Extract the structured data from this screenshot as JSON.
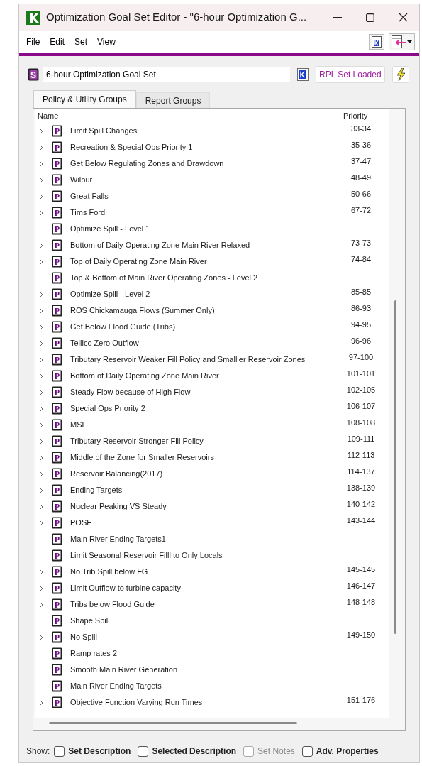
{
  "window": {
    "title": "Optimization Goal Set Editor - \"6-hour Optimization G..."
  },
  "menu": [
    "File",
    "Edit",
    "Set",
    "View"
  ],
  "set_name": {
    "icon": "S",
    "value": "6-hour Optimization Goal Set"
  },
  "rpl_status": "RPL Set Loaded",
  "tabs": [
    {
      "label": "Policy & Utility Groups",
      "selected": true
    },
    {
      "label": "Report Groups",
      "selected": false
    }
  ],
  "tree": {
    "columns": [
      "Name",
      "Priority"
    ],
    "rows": [
      {
        "icon": "P",
        "name": "Limit Spill Changes",
        "priority": "33-34",
        "expandable": true
      },
      {
        "icon": "P",
        "name": "Recreation & Special Ops Priority 1",
        "priority": "35-36",
        "expandable": true
      },
      {
        "icon": "P",
        "name": "Get Below Regulating Zones and Drawdown",
        "priority": "37-47",
        "expandable": true
      },
      {
        "icon": "P",
        "name": "Wilbur",
        "priority": "48-49",
        "expandable": true
      },
      {
        "icon": "P",
        "name": "Great Falls",
        "priority": "50-66",
        "expandable": true
      },
      {
        "icon": "P",
        "name": "Tims Ford",
        "priority": "67-72",
        "expandable": true
      },
      {
        "icon": "P",
        "name": "Optimize Spill - Level 1",
        "expandable": false
      },
      {
        "icon": "P",
        "name": "Bottom of Daily Operating Zone Main River Relaxed",
        "priority": "73-73",
        "expandable": true
      },
      {
        "icon": "P",
        "name": "Top of Daily Operating Zone Main River",
        "priority": "74-84",
        "expandable": true
      },
      {
        "icon": "P",
        "name": "Top & Bottom of Main River Operating Zones - Level 2",
        "expandable": false
      },
      {
        "icon": "P",
        "name": "Optimize Spill - Level 2",
        "priority": "85-85",
        "expandable": true
      },
      {
        "icon": "P",
        "name": "ROS Chickamauga Flows (Summer Only)",
        "priority": "86-93",
        "expandable": true
      },
      {
        "icon": "P",
        "name": "Get Below Flood Guide (Tribs)",
        "priority": "94-95",
        "expandable": true
      },
      {
        "icon": "P",
        "name": "Tellico Zero Outflow",
        "priority": "96-96",
        "expandable": true
      },
      {
        "icon": "P",
        "name": "Tributary Reservoir Weaker Fill Policy and Smalller Reservoir Zones",
        "priority": "97-100",
        "expandable": true
      },
      {
        "icon": "P",
        "name": "Bottom of Daily Operating Zone Main River",
        "priority": "101-101",
        "expandable": true
      },
      {
        "icon": "P",
        "name": "Steady Flow because of High Flow",
        "priority": "102-105",
        "expandable": true
      },
      {
        "icon": "P",
        "name": "Special Ops Priority 2",
        "priority": "106-107",
        "expandable": true
      },
      {
        "icon": "P",
        "name": "MSL",
        "priority": "108-108",
        "expandable": true
      },
      {
        "icon": "P",
        "name": "Tributary Reservoir Stronger Fill Policy",
        "priority": "109-111",
        "expandable": true
      },
      {
        "icon": "P",
        "name": "Middle of the Zone for Smaller Reservoirs",
        "priority": "112-113",
        "expandable": true
      },
      {
        "icon": "P",
        "name": "Reservoir Balancing(2017)",
        "priority": "114-137",
        "expandable": true
      },
      {
        "icon": "P",
        "name": "Ending Targets",
        "priority": "138-139",
        "expandable": true
      },
      {
        "icon": "P",
        "name": "Nuclear Peaking VS Steady",
        "priority": "140-142",
        "expandable": true
      },
      {
        "icon": "P",
        "name": "POSE",
        "priority": "143-144",
        "expandable": true
      },
      {
        "icon": "P",
        "name": "Main River Ending Targets1",
        "expandable": false
      },
      {
        "icon": "P",
        "name": "Limit Seasonal Reservoir Filll to Only Locals",
        "expandable": false
      },
      {
        "icon": "P",
        "name": "No Trib Spill below FG",
        "priority": "145-145",
        "expandable": true
      },
      {
        "icon": "P",
        "name": "Limit Outflow to turbine capacity",
        "priority": "146-147",
        "expandable": true
      },
      {
        "icon": "P",
        "name": "Tribs below Flood Guide",
        "priority": "148-148",
        "expandable": true
      },
      {
        "icon": "P",
        "name": "Shape Spill",
        "expandable": false
      },
      {
        "icon": "P",
        "name": "No Spill",
        "priority": "149-150",
        "expandable": true
      },
      {
        "icon": "P",
        "name": "Ramp rates 2",
        "expandable": false
      },
      {
        "icon": "P",
        "name": "Smooth Main River Generation",
        "expandable": false
      },
      {
        "icon": "P",
        "name": "Main River Ending Targets",
        "expandable": false
      },
      {
        "icon": "P",
        "name": "Objective Function Varying Run Times",
        "priority": "151-176",
        "expandable": true
      }
    ]
  },
  "show": {
    "label": "Show:",
    "options": [
      {
        "label": "Set Description",
        "checked": false,
        "disabled": false
      },
      {
        "label": "Selected Description",
        "checked": false,
        "disabled": false
      },
      {
        "label": "Set Notes",
        "checked": false,
        "disabled": true
      },
      {
        "label": "Adv. Properties",
        "checked": false,
        "disabled": false
      }
    ]
  }
}
